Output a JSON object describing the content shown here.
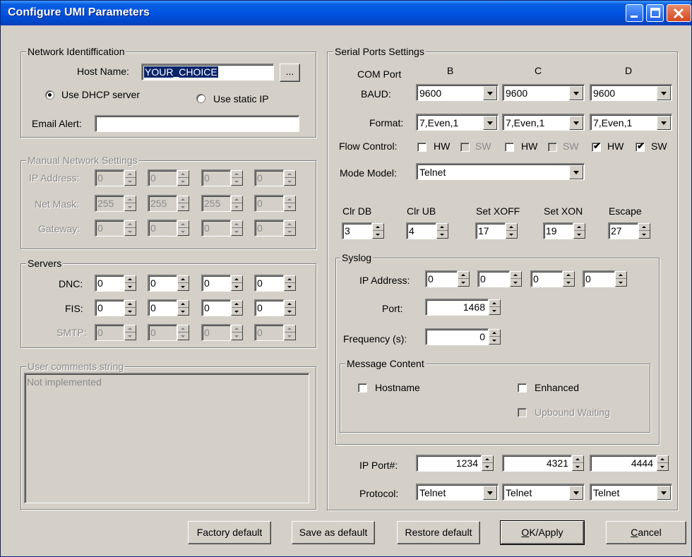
{
  "window": {
    "title": "Configure UMI Parameters"
  },
  "network": {
    "legend": "Network Identiffication",
    "host_label": "Host Name:",
    "host_value": "YOUR_CHOICE",
    "browse_label": "...",
    "dhcp_label": "Use DHCP server",
    "static_label": "Use static IP",
    "email_label": "Email Alert:",
    "email_value": ""
  },
  "manual": {
    "legend": "Manual Network Settings",
    "ip_label": "IP Address:",
    "mask_label": "Net Mask:",
    "gateway_label": "Gateway:",
    "ip": [
      "0",
      "0",
      "0",
      "0"
    ],
    "mask": [
      "255",
      "255",
      "255",
      "0"
    ],
    "gateway": [
      "0",
      "0",
      "0",
      "0"
    ]
  },
  "servers": {
    "legend": "Servers",
    "dnc_label": "DNC:",
    "fis_label": "FIS:",
    "smtp_label": "SMTP:",
    "dnc": [
      "0",
      "0",
      "0",
      "0"
    ],
    "fis": [
      "0",
      "0",
      "0",
      "0"
    ],
    "smtp": [
      "0",
      "0",
      "0",
      "0"
    ]
  },
  "comments": {
    "legend": "User comments string",
    "text": "Not implemented"
  },
  "serial": {
    "legend": "Serial Ports Settings",
    "com_label": "COM Port",
    "ports": [
      "B",
      "C",
      "D"
    ],
    "baud_label": "BAUD:",
    "baud": [
      "9600",
      "9600",
      "9600"
    ],
    "format_label": "Format:",
    "format": [
      "7,Even,1",
      "7,Even,1",
      "7,Even,1"
    ],
    "flow_label": "Flow Control:",
    "hw_label": "HW",
    "sw_label": "SW",
    "flow": [
      {
        "hw": false,
        "sw": false
      },
      {
        "hw": false,
        "sw": false
      },
      {
        "hw": true,
        "sw": true
      }
    ],
    "mode_label": "Mode Model:",
    "mode_value": "Telnet",
    "clr_db_label": "Clr DB",
    "clr_ub_label": "Clr UB",
    "set_xoff_label": "Set XOFF",
    "set_xon_label": "Set XON",
    "escape_label": "Escape",
    "clr_db": "3",
    "clr_ub": "4",
    "set_xoff": "17",
    "set_xon": "19",
    "escape": "27"
  },
  "syslog": {
    "legend": "Syslog",
    "ip_label": "IP Address:",
    "ip": [
      "0",
      "0",
      "0",
      "0"
    ],
    "port_label": "Port:",
    "port": "1468",
    "freq_label": "Frequency (s):",
    "freq": "0",
    "message_legend": "Message Content",
    "hostname_label": "Hostname",
    "enhanced_label": "Enhanced",
    "upbound_label": "Upbound Waiting"
  },
  "ipport": {
    "label": "IP Port#:",
    "values": [
      "1234",
      "4321",
      "4444"
    ],
    "protocol_label": "Protocol:",
    "protocols": [
      "Telnet",
      "Telnet",
      "Telnet"
    ]
  },
  "buttons": {
    "factory": "Factory default",
    "save": "Save as default",
    "restore": "Restore default",
    "ok": "OK/Apply",
    "cancel": "Cancel"
  }
}
